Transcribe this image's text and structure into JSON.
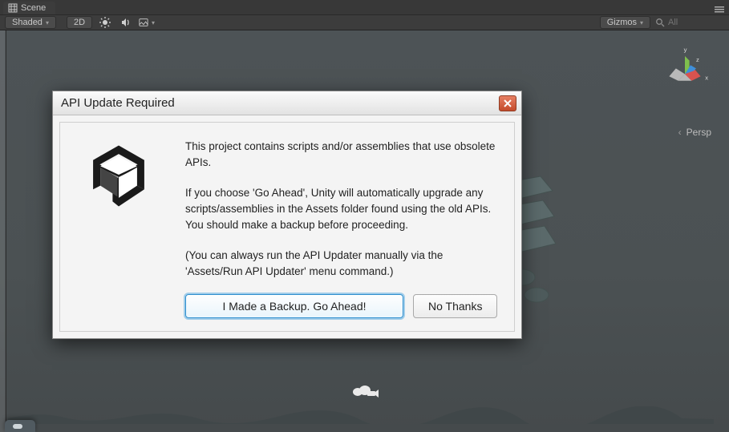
{
  "tab": {
    "scene_label": "Scene"
  },
  "toolbar": {
    "shading_label": "Shaded",
    "mode2d_label": "2D",
    "gizmos_label": "Gizmos",
    "search_placeholder": "All"
  },
  "viewport": {
    "projection_label": "Persp",
    "axes": {
      "x": "x",
      "y": "y",
      "z": "z"
    }
  },
  "dialog": {
    "title": "API Update Required",
    "p1": "This project contains scripts and/or assemblies that use obsolete APIs.",
    "p2": "If you choose 'Go Ahead', Unity will automatically upgrade any scripts/assemblies in the Assets folder found using the old APIs. You should make a backup before proceeding.",
    "p3": "(You can always run the API Updater manually via the 'Assets/Run API Updater' menu command.)",
    "primary_label": "I Made a Backup. Go Ahead!",
    "secondary_label": "No Thanks"
  }
}
